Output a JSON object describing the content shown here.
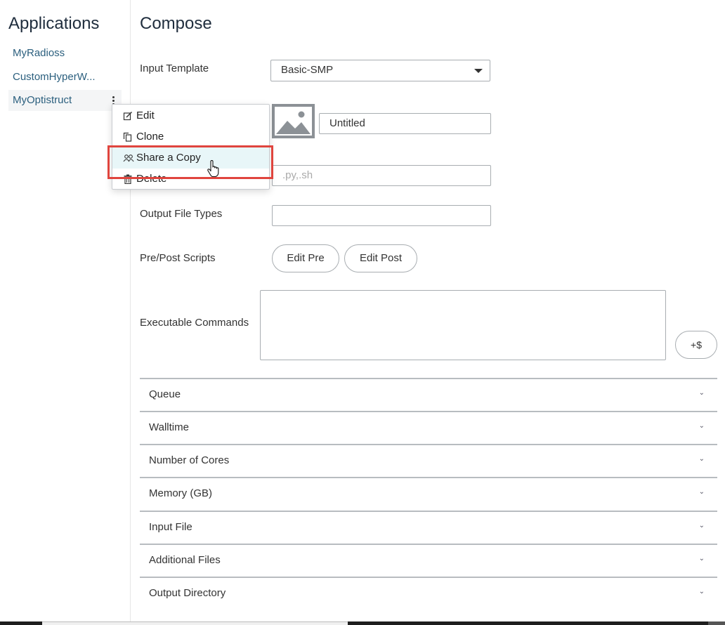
{
  "sidebar": {
    "title": "Applications",
    "items": [
      {
        "label": "MyRadioss"
      },
      {
        "label": "CustomHyperW..."
      },
      {
        "label": "MyOptistruct",
        "active": true
      }
    ]
  },
  "context_menu": {
    "items": [
      {
        "label": "Edit",
        "icon": "edit-icon"
      },
      {
        "label": "Clone",
        "icon": "clone-icon"
      },
      {
        "label": "Share a Copy",
        "icon": "users-icon",
        "hovered": true
      },
      {
        "label": "Delete",
        "icon": "trash-icon"
      }
    ],
    "highlight_color": "#e0453e"
  },
  "compose": {
    "title": "Compose",
    "input_template": {
      "label": "Input Template",
      "value": "Basic-SMP"
    },
    "name_field": {
      "value": "Untitled"
    },
    "script_field": {
      "placeholder": ".py,.sh"
    },
    "output_file_types": {
      "label": "Output File Types",
      "value": ""
    },
    "pre_post": {
      "label": "Pre/Post Scripts",
      "edit_pre": "Edit Pre",
      "edit_post": "Edit Post"
    },
    "executable_commands": {
      "label": "Executable Commands",
      "value": "",
      "add_var_button": "+$"
    },
    "sections": [
      {
        "label": "Queue"
      },
      {
        "label": "Walltime"
      },
      {
        "label": "Number of Cores"
      },
      {
        "label": "Memory (GB)"
      },
      {
        "label": "Input File"
      },
      {
        "label": "Additional Files"
      },
      {
        "label": "Output Directory"
      }
    ]
  }
}
